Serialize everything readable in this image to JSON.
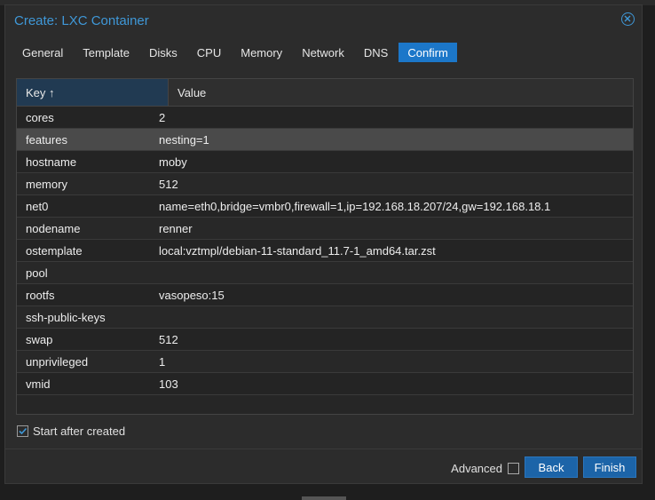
{
  "window": {
    "title": "Create: LXC Container"
  },
  "tabs": [
    {
      "label": "General"
    },
    {
      "label": "Template"
    },
    {
      "label": "Disks"
    },
    {
      "label": "CPU"
    },
    {
      "label": "Memory"
    },
    {
      "label": "Network"
    },
    {
      "label": "DNS"
    },
    {
      "label": "Confirm"
    }
  ],
  "grid": {
    "key_header": "Key ↑",
    "value_header": "Value",
    "rows": [
      {
        "key": "cores",
        "value": "2"
      },
      {
        "key": "features",
        "value": "nesting=1"
      },
      {
        "key": "hostname",
        "value": "moby"
      },
      {
        "key": "memory",
        "value": "512"
      },
      {
        "key": "net0",
        "value": "name=eth0,bridge=vmbr0,firewall=1,ip=192.168.18.207/24,gw=192.168.18.1"
      },
      {
        "key": "nodename",
        "value": "renner"
      },
      {
        "key": "ostemplate",
        "value": "local:vztmpl/debian-11-standard_11.7-1_amd64.tar.zst"
      },
      {
        "key": "pool",
        "value": ""
      },
      {
        "key": "rootfs",
        "value": "vasopeso:15"
      },
      {
        "key": "ssh-public-keys",
        "value": ""
      },
      {
        "key": "swap",
        "value": "512"
      },
      {
        "key": "unprivileged",
        "value": "1"
      },
      {
        "key": "vmid",
        "value": "103"
      }
    ]
  },
  "start_after_created": {
    "label": "Start after created",
    "checked": true
  },
  "footer": {
    "advanced_label": "Advanced",
    "back_label": "Back",
    "finish_label": "Finish"
  }
}
